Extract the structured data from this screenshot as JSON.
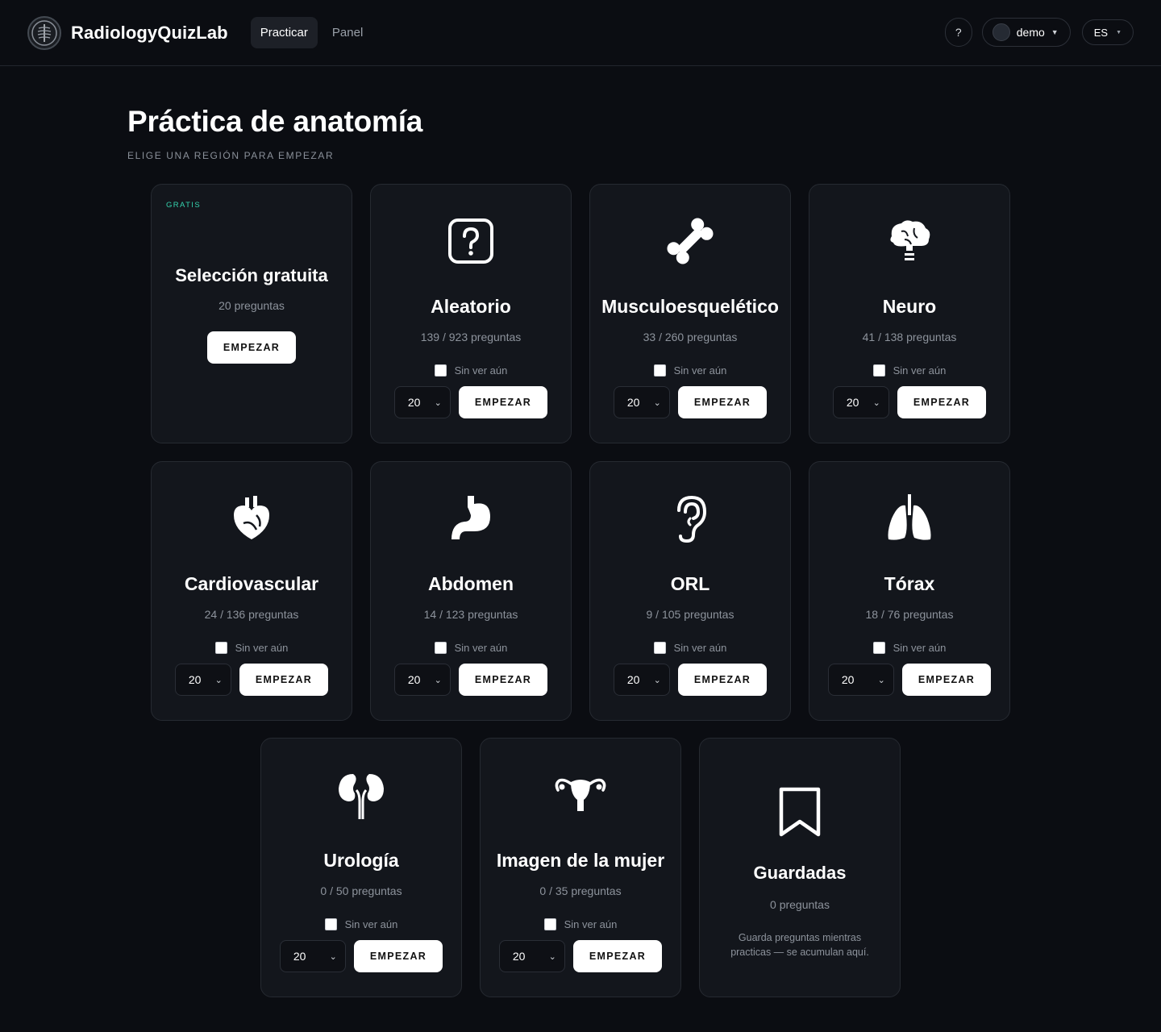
{
  "header": {
    "brand": "RadiologyQuizLab",
    "tabs": [
      {
        "label": "Practicar"
      },
      {
        "label": "Panel"
      }
    ],
    "help_label": "?",
    "user": {
      "name": "demo"
    },
    "lang": "ES"
  },
  "page": {
    "title": "Práctica de anatomía",
    "subtitle": "ELIGE UNA REGIÓN PARA EMPEZAR"
  },
  "free_card": {
    "badge": "GRATIS",
    "title": "Selección gratuita",
    "count": "20 preguntas",
    "button": "EMPEZAR"
  },
  "unseen_label": "Sin ver aún",
  "start_label": "EMPEZAR",
  "cards": [
    {
      "title": "Aleatorio",
      "count": "139 / 923 preguntas",
      "select": "20",
      "icon": "question-icon"
    },
    {
      "title": "Musculoesquelético",
      "count": "33 / 260 preguntas",
      "select": "20",
      "icon": "bone-icon"
    },
    {
      "title": "Neuro",
      "count": "41 / 138 preguntas",
      "select": "20",
      "icon": "brain-icon"
    },
    {
      "title": "Cardiovascular",
      "count": "24 / 136 preguntas",
      "select": "20",
      "icon": "heart-icon"
    },
    {
      "title": "Abdomen",
      "count": "14 / 123 preguntas",
      "select": "20",
      "icon": "stomach-icon"
    },
    {
      "title": "ORL",
      "count": "9 / 105 preguntas",
      "select": "20",
      "icon": "ear-icon"
    },
    {
      "title": "Tórax",
      "count": "18 / 76 preguntas",
      "select": "20",
      "icon": "lungs-icon"
    },
    {
      "title": "Urología",
      "count": "0 / 50 preguntas",
      "select": "20",
      "icon": "kidneys-icon"
    },
    {
      "title": "Imagen de la mujer",
      "count": "0 / 35 preguntas",
      "select": "20",
      "icon": "uterus-icon"
    }
  ],
  "saved_card": {
    "title": "Guardadas",
    "count": "0 preguntas",
    "note": "Guarda preguntas mientras practicas — se acumulan aquí.",
    "icon": "bookmark-icon"
  }
}
